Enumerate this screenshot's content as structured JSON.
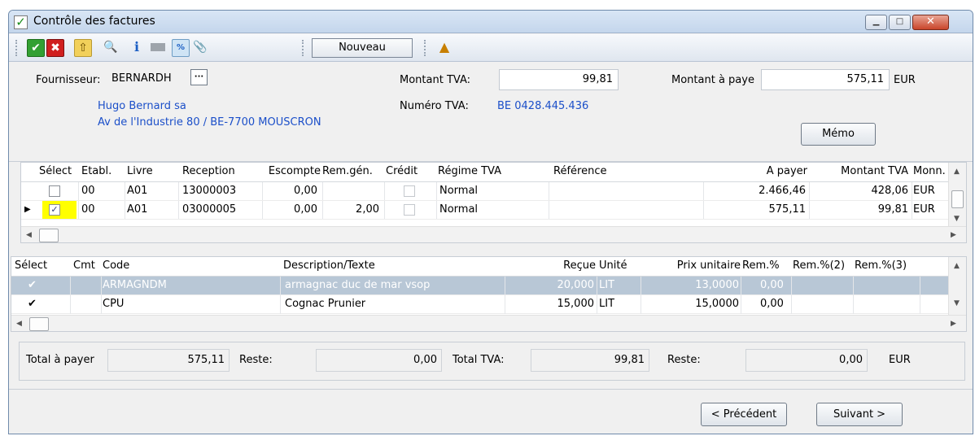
{
  "window": {
    "title": "Contrôle des factures",
    "app_icon": "checkmark-icon",
    "min": "▁",
    "max": "□",
    "close": "✕"
  },
  "toolbar": {
    "ok": "✔",
    "cancel": "✖",
    "export": "⇧",
    "search": "🔍",
    "info": "ℹ",
    "percent": "%",
    "attach": "📎",
    "nouveau_label": "Nouveau",
    "folder": "▲"
  },
  "supplier": {
    "label": "Fournisseur:",
    "code": "BERNARDH",
    "lookup": "···",
    "name": "Hugo Bernard sa",
    "address": "Av de l'Industrie 80 / BE-7700 MOUSCRON",
    "vat_amount_label": "Montant TVA:",
    "vat_amount": "99,81",
    "vat_number_label": "Numéro TVA:",
    "vat_number": "BE 0428.445.436",
    "pay_label": "Montant à paye",
    "pay_amount": "575,11",
    "currency": "EUR",
    "memo_label": "Mémo"
  },
  "invoices": {
    "headers": [
      "Sélect",
      "Etabl.",
      "Livre",
      "Reception",
      "Escompte",
      "Rem.gén.",
      "Crédit",
      "Régime TVA",
      "Référence",
      "A payer",
      "Montant TVA",
      "Monn."
    ],
    "rows": [
      {
        "selected": false,
        "etabl": "00",
        "livre": "A01",
        "reception": "13000003",
        "escompte": "0,00",
        "remgen": "",
        "credit": false,
        "regime": "Normal",
        "reference": "",
        "apayer": "2.466,46",
        "montant": "428,06",
        "monn": "EUR"
      },
      {
        "selected": true,
        "etabl": "00",
        "livre": "A01",
        "reception": "03000005",
        "escompte": "0,00",
        "remgen": "2,00",
        "credit": false,
        "regime": "Normal",
        "reference": "",
        "apayer": "575,11",
        "montant": "99,81",
        "monn": "EUR"
      }
    ],
    "current_row_marker": "▶"
  },
  "lines": {
    "headers": [
      "Sélect",
      "Cmt",
      "Code",
      "Description/Texte",
      "Reçue",
      "Unité",
      "Prix unitaire",
      "Rem.%",
      "Rem.%(2)",
      "Rem.%(3)"
    ],
    "rows": [
      {
        "check": "✔",
        "code": "ARMAGNDM",
        "desc": "armagnac duc de mar vsop",
        "recue": "20,000",
        "unite": "LIT",
        "prix": "13,0000",
        "rem": "0,00"
      },
      {
        "check": "✔",
        "code": "CPU",
        "desc": "Cognac Prunier",
        "recue": "15,000",
        "unite": "LIT",
        "prix": "15,0000",
        "rem": "0,00"
      }
    ]
  },
  "totals": {
    "total_pay_label": "Total à payer",
    "total_pay": "575,11",
    "reste_label": "Reste:",
    "reste1": "0,00",
    "total_vat_label": "Total TVA:",
    "total_vat": "99,81",
    "reste2": "0,00",
    "currency": "EUR"
  },
  "footer": {
    "prev": "< Précédent",
    "next": "Suivant >"
  },
  "scroll": {
    "up": "▲",
    "down": "▼",
    "left": "◀",
    "right": "▶"
  },
  "colors": {
    "accent": "#1b4fc9",
    "selection_highlight": "#ffff00",
    "inactive_row": "#b8c7d6"
  }
}
